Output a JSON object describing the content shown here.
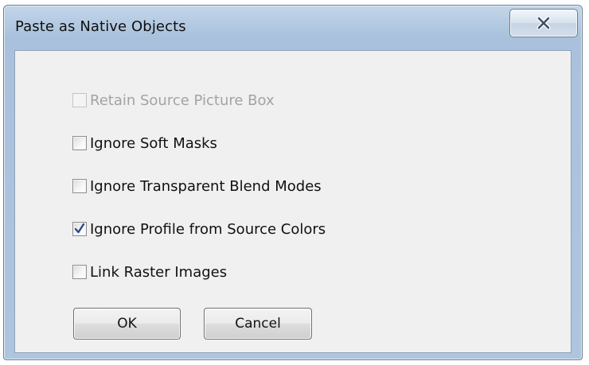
{
  "window": {
    "title": "Paste as Native Objects",
    "close_icon": "close-icon"
  },
  "options": [
    {
      "label": "Retain Source Picture Box",
      "checked": false,
      "enabled": false
    },
    {
      "label": "Ignore Soft Masks",
      "checked": false,
      "enabled": true
    },
    {
      "label": "Ignore Transparent Blend Modes",
      "checked": false,
      "enabled": true
    },
    {
      "label": "Ignore Profile from Source Colors",
      "checked": true,
      "enabled": true
    },
    {
      "label": "Link Raster Images",
      "checked": false,
      "enabled": true
    }
  ],
  "buttons": {
    "ok_label": "OK",
    "cancel_label": "Cancel"
  },
  "colors": {
    "titlebar": "#b4c9e0",
    "client_background": "#f0f0f0",
    "checkmark": "#2b4a8a",
    "disabled_text": "#a3a3a3"
  }
}
